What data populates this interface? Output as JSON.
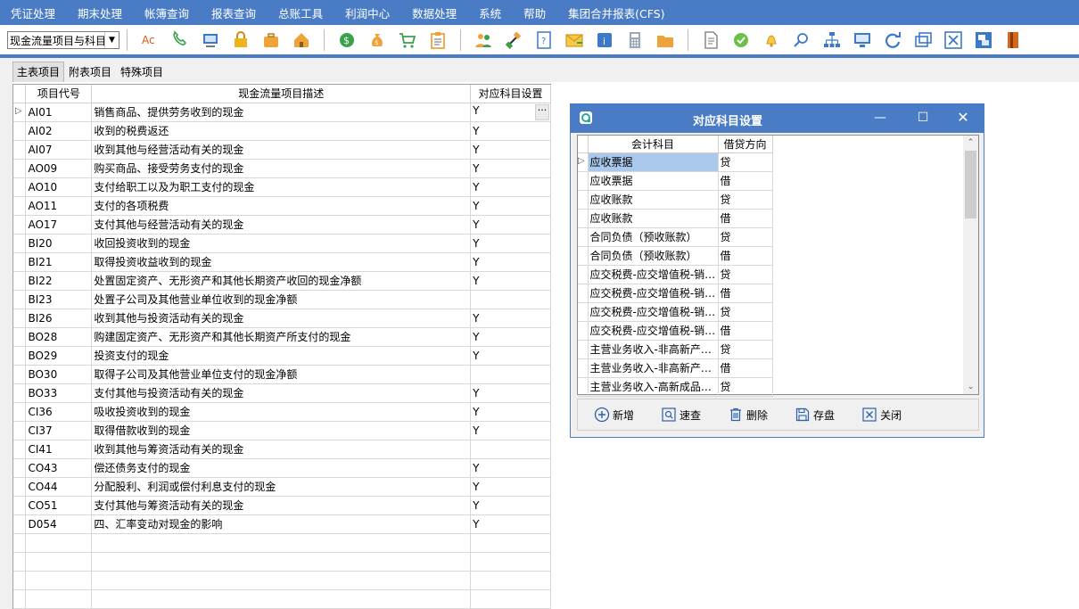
{
  "menu": [
    "凭证处理",
    "期末处理",
    "帐簿查询",
    "报表查询",
    "总账工具",
    "利润中心",
    "数据处理",
    "系统",
    "帮助",
    "集团合并报表(CFS)"
  ],
  "toolbar": {
    "select_value": "现金流量项目与科目",
    "icons": [
      "spellcheck-icon",
      "phone-icon",
      "computer-icon",
      "lock-icon",
      "briefcase-icon",
      "home-icon",
      "dollar-icon",
      "money-bag-icon",
      "cart-icon",
      "clipboard-icon",
      "users-icon",
      "link-icon",
      "help-doc-icon",
      "mail-icon",
      "info-icon",
      "calculator-icon",
      "folder-icon",
      "document-icon",
      "check-icon",
      "bell-icon",
      "search-icon",
      "org-chart-icon",
      "monitor-icon",
      "refresh-icon",
      "restore-window-icon",
      "close-window-icon",
      "switch-window-icon",
      "exit-icon"
    ]
  },
  "tabs": [
    "主表项目",
    "附表项目",
    "特殊项目"
  ],
  "grid": {
    "headers": [
      "项目代号",
      "现金流量项目描述",
      "对应科目设置"
    ],
    "rows": [
      {
        "code": "AI01",
        "desc": "销售商品、提供劳务收到的现金",
        "set": "Y"
      },
      {
        "code": "AI02",
        "desc": "收到的税费返还",
        "set": "Y"
      },
      {
        "code": "AI07",
        "desc": "收到其他与经营活动有关的现金",
        "set": "Y"
      },
      {
        "code": "AO09",
        "desc": "购买商品、接受劳务支付的现金",
        "set": "Y"
      },
      {
        "code": "AO10",
        "desc": "支付给职工以及为职工支付的现金",
        "set": "Y"
      },
      {
        "code": "AO11",
        "desc": "支付的各项税费",
        "set": "Y"
      },
      {
        "code": "AO17",
        "desc": "支付其他与经营活动有关的现金",
        "set": "Y"
      },
      {
        "code": "BI20",
        "desc": "收回投资收到的现金",
        "set": "Y"
      },
      {
        "code": "BI21",
        "desc": "取得投资收益收到的现金",
        "set": "Y"
      },
      {
        "code": "BI22",
        "desc": "处置固定资产、无形资产和其他长期资产收回的现金净额",
        "set": "Y"
      },
      {
        "code": "BI23",
        "desc": "处置子公司及其他营业单位收到的现金净额",
        "set": ""
      },
      {
        "code": "BI26",
        "desc": "收到其他与投资活动有关的现金",
        "set": "Y"
      },
      {
        "code": "BO28",
        "desc": "购建固定资产、无形资产和其他长期资产所支付的现金",
        "set": "Y"
      },
      {
        "code": "BO29",
        "desc": "投资支付的现金",
        "set": "Y"
      },
      {
        "code": "BO30",
        "desc": "取得子公司及其他营业单位支付的现金净额",
        "set": ""
      },
      {
        "code": "BO33",
        "desc": "支付其他与投资活动有关的现金",
        "set": "Y"
      },
      {
        "code": "CI36",
        "desc": "吸收投资收到的现金",
        "set": "Y"
      },
      {
        "code": "CI37",
        "desc": "取得借款收到的现金",
        "set": "Y"
      },
      {
        "code": "CI41",
        "desc": "收到其他与筹资活动有关的现金",
        "set": ""
      },
      {
        "code": "CO43",
        "desc": "偿还债务支付的现金",
        "set": "Y"
      },
      {
        "code": "CO44",
        "desc": "分配股利、利润或偿付利息支付的现金",
        "set": "Y"
      },
      {
        "code": "CO51",
        "desc": "支付其他与筹资活动有关的现金",
        "set": "Y"
      },
      {
        "code": "D054",
        "desc": "四、汇率变动对现金的影响",
        "set": "Y"
      }
    ],
    "ellipsis": "···"
  },
  "dialog": {
    "title": "对应科目设置",
    "headers": [
      "会计科目",
      "借贷方向"
    ],
    "rows": [
      {
        "account": "应收票据",
        "dir": "贷"
      },
      {
        "account": "应收票据",
        "dir": "借"
      },
      {
        "account": "应收账款",
        "dir": "贷"
      },
      {
        "account": "应收账款",
        "dir": "借"
      },
      {
        "account": "合同负债（预收账款）",
        "dir": "贷"
      },
      {
        "account": "合同负债（预收账款）",
        "dir": "借"
      },
      {
        "account": "应交税费-应交增值税-销…",
        "dir": "贷"
      },
      {
        "account": "应交税费-应交增值税-销…",
        "dir": "借"
      },
      {
        "account": "应交税费-应交增值税-销…",
        "dir": "贷"
      },
      {
        "account": "应交税费-应交增值税-销…",
        "dir": "借"
      },
      {
        "account": "主营业务收入-非高新产…",
        "dir": "贷"
      },
      {
        "account": "主营业务收入-非高新产…",
        "dir": "借"
      },
      {
        "account": "主营业务收入-高新成品…",
        "dir": "贷"
      }
    ],
    "buttons": {
      "add": "新增",
      "find": "速查",
      "delete": "删除",
      "save": "存盘",
      "close": "关闭"
    }
  }
}
